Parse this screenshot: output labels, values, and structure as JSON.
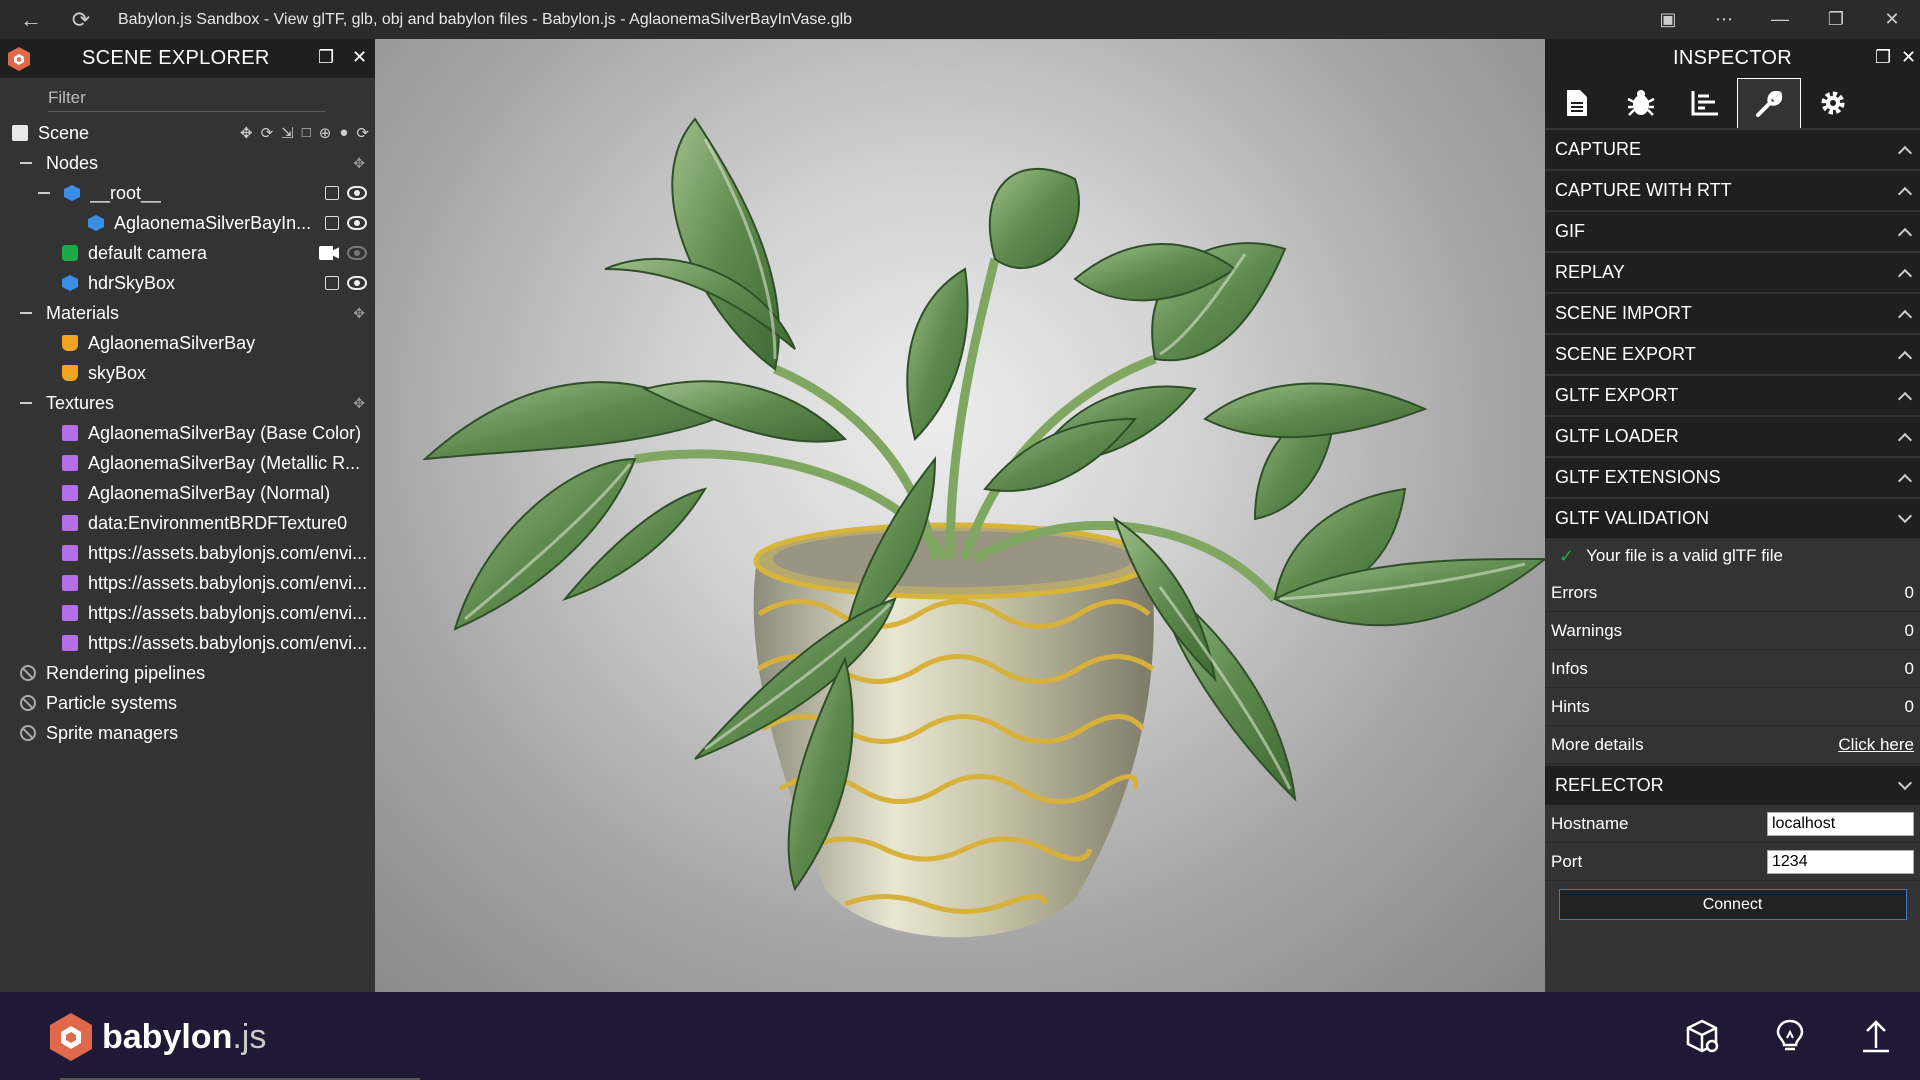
{
  "window": {
    "title": "Babylon.js Sandbox - View glTF, glb, obj and babylon files - Babylon.js - AglaonemaSilverBayInVase.glb"
  },
  "scene_explorer": {
    "title": "SCENE EXPLORER",
    "filter_placeholder": "Filter",
    "scene_label": "Scene",
    "nodes": {
      "label": "Nodes",
      "root": "__root__",
      "child": "AglaonemaSilverBayIn...",
      "camera": "default camera",
      "skybox": "hdrSkyBox"
    },
    "materials": {
      "label": "Materials",
      "items": [
        "AglaonemaSilverBay",
        "skyBox"
      ]
    },
    "textures": {
      "label": "Textures",
      "items": [
        "AglaonemaSilverBay (Base Color)",
        "AglaonemaSilverBay (Metallic R...",
        "AglaonemaSilverBay (Normal)",
        "data:EnvironmentBRDFTexture0",
        "https://assets.babylonjs.com/envi...",
        "https://assets.babylonjs.com/envi...",
        "https://assets.babylonjs.com/envi...",
        "https://assets.babylonjs.com/envi..."
      ]
    },
    "extras": [
      "Rendering pipelines",
      "Particle systems",
      "Sprite managers"
    ]
  },
  "inspector": {
    "title": "INSPECTOR",
    "sections": [
      "CAPTURE",
      "CAPTURE WITH RTT",
      "GIF",
      "REPLAY",
      "SCENE IMPORT",
      "SCENE EXPORT",
      "GLTF EXPORT",
      "GLTF LOADER",
      "GLTF EXTENSIONS",
      "GLTF VALIDATION"
    ],
    "validation": {
      "message": "Your file is a valid glTF file",
      "rows": [
        {
          "label": "Errors",
          "value": "0"
        },
        {
          "label": "Warnings",
          "value": "0"
        },
        {
          "label": "Infos",
          "value": "0"
        },
        {
          "label": "Hints",
          "value": "0"
        }
      ],
      "more_details_label": "More details",
      "more_details_link": "Click here"
    },
    "reflector": {
      "title": "REFLECTOR",
      "hostname_label": "Hostname",
      "hostname_value": "localhost",
      "port_label": "Port",
      "port_value": "1234",
      "connect_label": "Connect"
    }
  },
  "footer": {
    "brand": "babylon",
    "brand_suffix": ".js"
  },
  "colors": {
    "accent_blue": "#3a7bc8",
    "footer_bg": "#201936",
    "panel_bg": "#333333",
    "logo_red": "#e0684b"
  },
  "icons": {
    "inspector_tabs": [
      "document-icon",
      "bug-icon",
      "statistics-icon",
      "wrench-icon",
      "gear-icon"
    ],
    "footer": [
      "inspector-cube-icon",
      "light-bulb-icon",
      "upload-icon"
    ]
  }
}
